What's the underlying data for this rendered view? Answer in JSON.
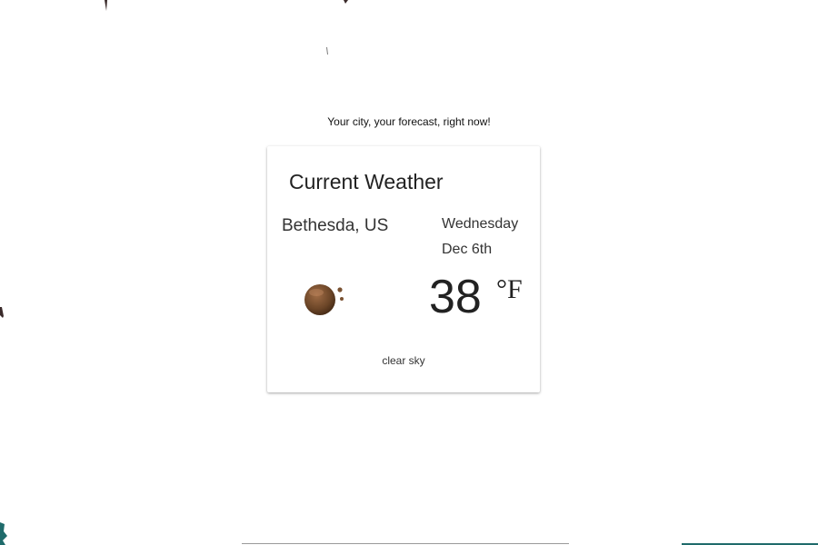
{
  "tagline": "Your city, your forecast, right now!",
  "card": {
    "title": "Current Weather",
    "location": "Bethesda, US",
    "day": "Wednesday",
    "date": "Dec 6th",
    "temperature": "38",
    "unit": "°F",
    "description": "clear sky",
    "icon": "clear-night-moon-icon"
  },
  "colors": {
    "moon_dark": "#5a3b22",
    "moon_light": "#a06c45",
    "background_fragment_dark": "#3a2a2a",
    "background_fragment_teal": "#1f6b6b"
  }
}
